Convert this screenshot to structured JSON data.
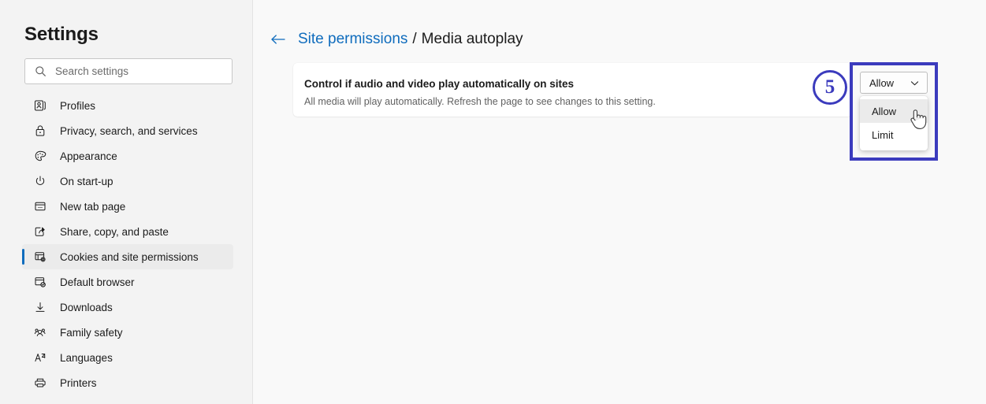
{
  "sidebar": {
    "title": "Settings",
    "search": {
      "placeholder": "Search settings",
      "value": "",
      "icon": "search-icon"
    },
    "items": [
      {
        "label": "Profiles",
        "icon": "profiles-icon",
        "selected": false
      },
      {
        "label": "Privacy, search, and services",
        "icon": "lock-icon",
        "selected": false
      },
      {
        "label": "Appearance",
        "icon": "palette-icon",
        "selected": false
      },
      {
        "label": "On start-up",
        "icon": "power-icon",
        "selected": false
      },
      {
        "label": "New tab page",
        "icon": "new-tab-icon",
        "selected": false
      },
      {
        "label": "Share, copy, and paste",
        "icon": "share-icon",
        "selected": false
      },
      {
        "label": "Cookies and site permissions",
        "icon": "cookies-icon",
        "selected": true
      },
      {
        "label": "Default browser",
        "icon": "default-browser-icon",
        "selected": false
      },
      {
        "label": "Downloads",
        "icon": "download-icon",
        "selected": false
      },
      {
        "label": "Family safety",
        "icon": "family-icon",
        "selected": false
      },
      {
        "label": "Languages",
        "icon": "languages-icon",
        "selected": false
      },
      {
        "label": "Printers",
        "icon": "printer-icon",
        "selected": false
      }
    ]
  },
  "main": {
    "breadcrumb": {
      "back_icon": "back-arrow-icon",
      "parent": "Site permissions",
      "separator": "/",
      "current": "Media autoplay"
    },
    "setting": {
      "title": "Control if audio and video play automatically on sites",
      "description": "All media will play automatically. Refresh the page to see changes to this setting.",
      "dropdown": {
        "value": "Allow",
        "chevron_icon": "chevron-down-icon",
        "open": true,
        "options": [
          {
            "label": "Allow",
            "highlighted": true
          },
          {
            "label": "Limit",
            "highlighted": false
          }
        ]
      }
    }
  },
  "annotation": {
    "step_number": "5",
    "accent_color": "#3b3bbd",
    "cursor_icon": "hand-pointer-cursor"
  },
  "colors": {
    "sidebar_bg": "#f3f3f3",
    "content_bg": "#f9f9f9",
    "card_bg": "#ffffff",
    "link": "#0f6cbd",
    "text": "#1b1b1b",
    "muted_text": "#616161",
    "selected_item_bg": "#ebebeb",
    "selected_indicator": "#0f6cbd",
    "highlight_border": "#3b3bbd"
  }
}
